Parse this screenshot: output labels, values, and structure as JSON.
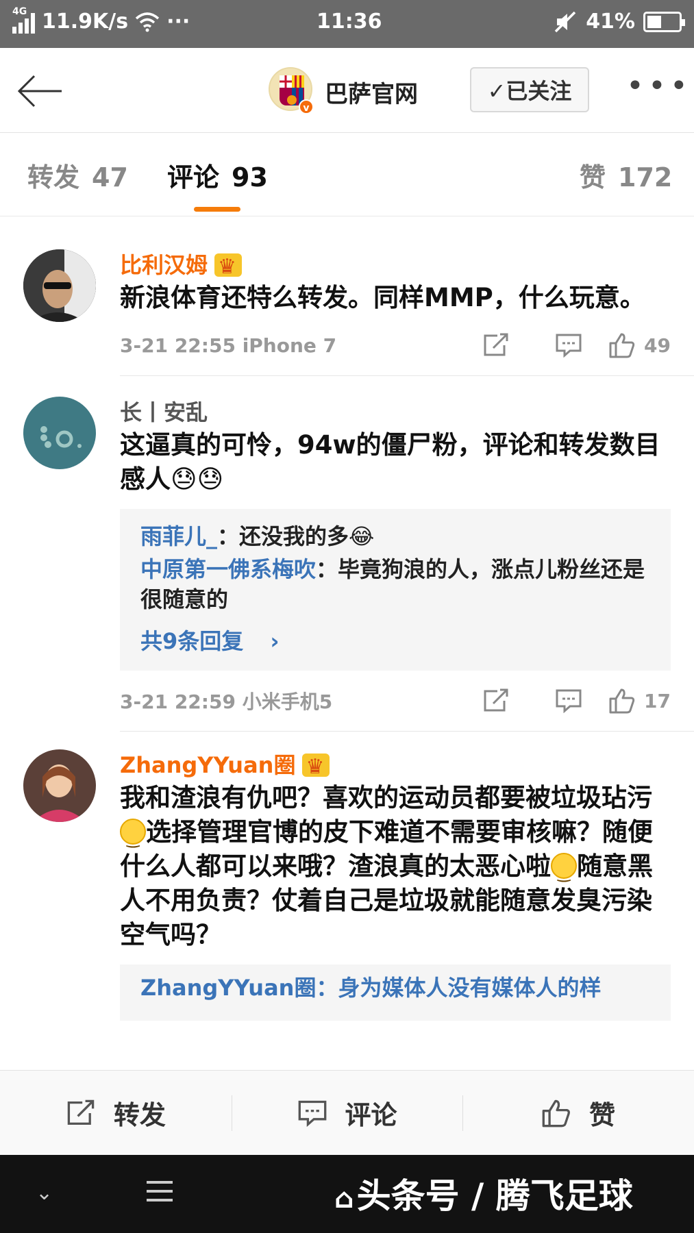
{
  "status_bar": {
    "network": "4G",
    "speed": "11.9K/s",
    "time": "11:36",
    "battery": "41%"
  },
  "header": {
    "account_name": "巴萨官网",
    "verified_badge": "v",
    "follow_label": "✓已关注"
  },
  "tabs": [
    {
      "label": "转发",
      "count": "47"
    },
    {
      "label": "评论",
      "count": "93"
    },
    {
      "label": "赞",
      "count": "172"
    }
  ],
  "comments": [
    {
      "user": "比利汉姆",
      "user_color": "#f56b0a",
      "text": "新浪体育还特么转发。同样MMP，什么玩意。",
      "meta": "3-21 22:55 iPhone 7",
      "likes": "49"
    },
    {
      "user": "长丨安乱",
      "user_color": "#555555",
      "text": "这逼真的可怜，94w的僵尸粉，评论和转发数目感人😓😓",
      "replies": [
        {
          "user": "雨菲儿_",
          "text": "：还没我的多😂"
        },
        {
          "user": "中原第一佛系梅吹",
          "text": "：毕竟狗浪的人，涨点儿粉丝还是很随意的"
        }
      ],
      "more_replies": "共9条回复",
      "meta": "3-21 22:59 小米手机5",
      "likes": "17"
    },
    {
      "user": "ZhangYYuan圈",
      "user_color": "#f56b0a",
      "text_parts": [
        "我和渣浪有仇吧？喜欢的运动员都要被垃圾玷污",
        "选择管理官博的皮下难道不需要审核嘛？随便什么人都可以来哦？渣浪真的太恶心啦",
        "随意黑人不用负责？仗着自己是垃圾就能随意发臭污染空气吗？"
      ],
      "reply_preview": "ZhangYYuan圈：身为媒体人没有媒体人的样"
    }
  ],
  "action_bar": {
    "repost": "转发",
    "comment": "评论",
    "like": "赞"
  },
  "watermark": "头条号 / 腾飞足球",
  "colors": {
    "accent": "#f57c0a",
    "link_blue": "#3b74b8",
    "status_bar_bg": "#6a6a6a"
  }
}
